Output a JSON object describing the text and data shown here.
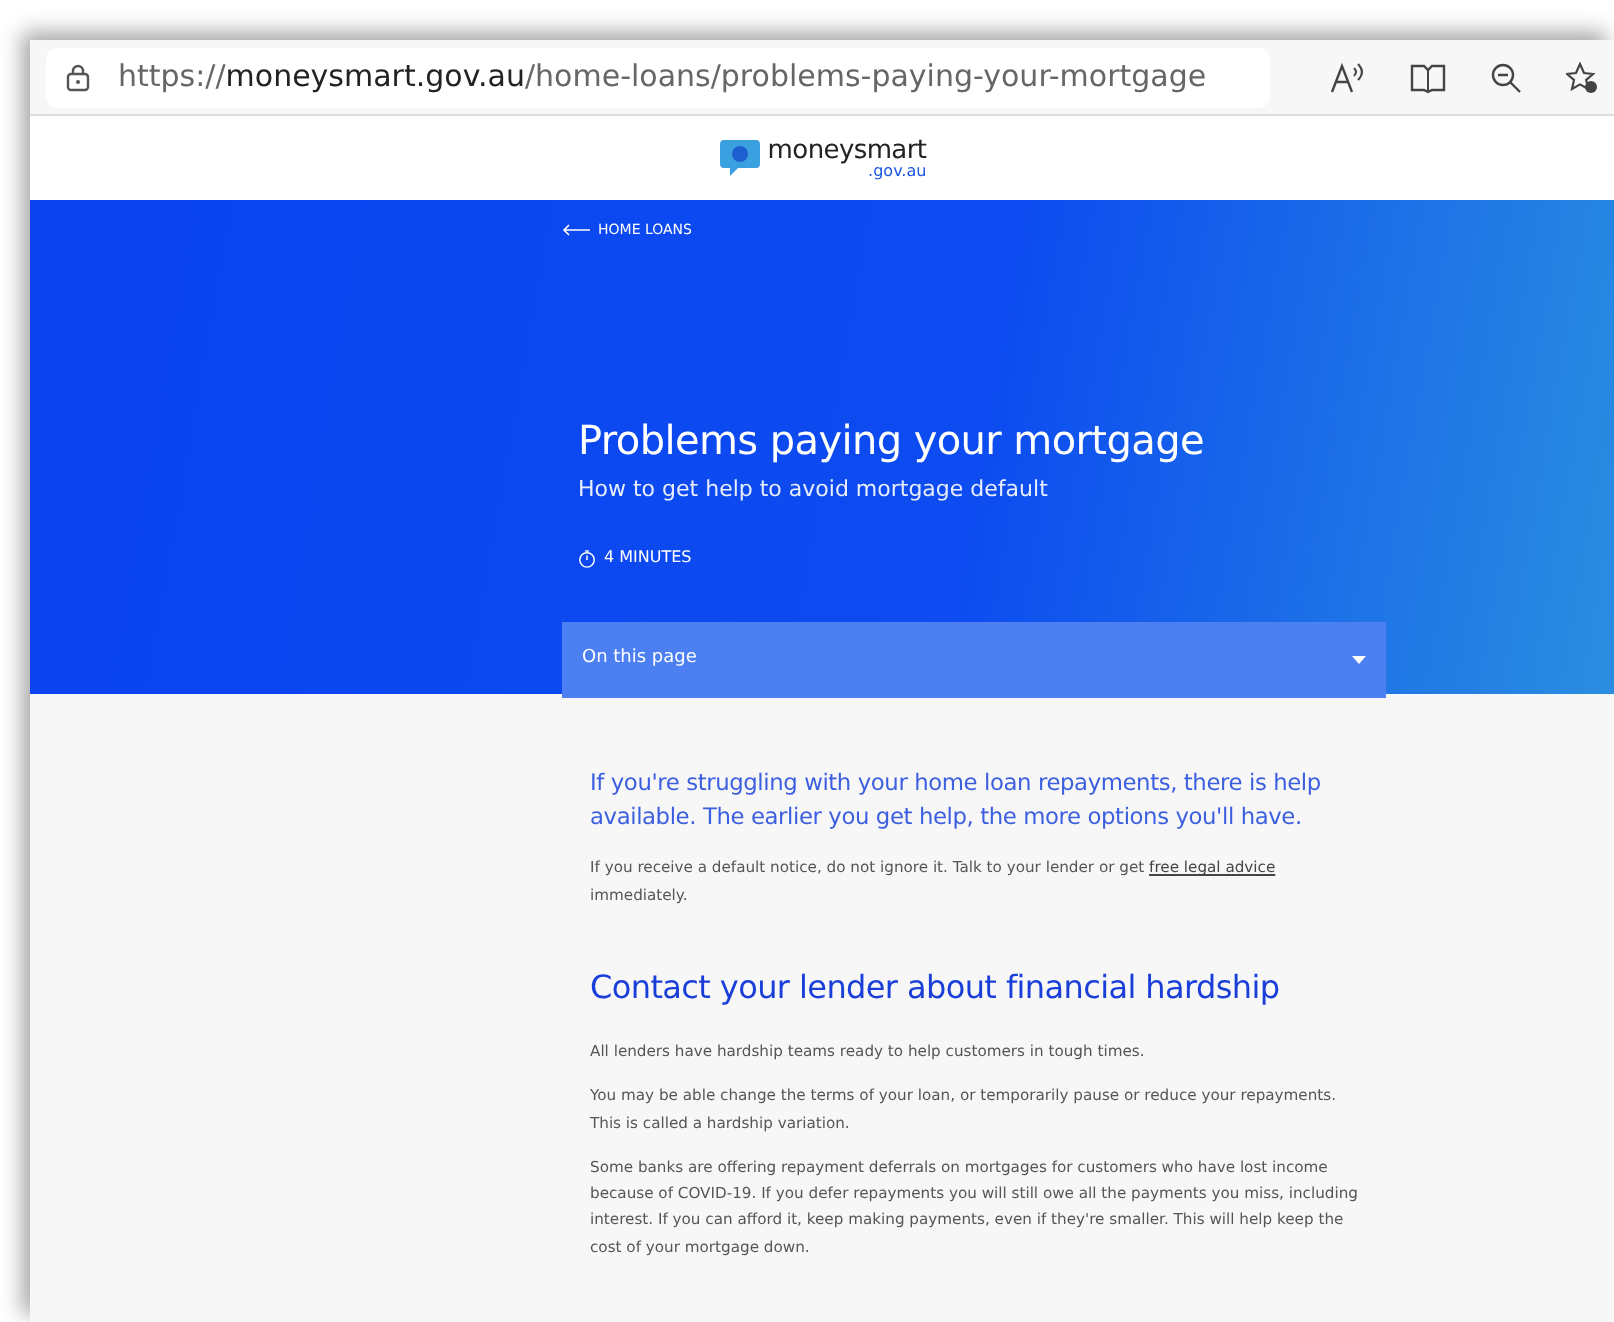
{
  "address_bar": {
    "scheme": "https://",
    "host": "moneysmart.gov.au",
    "path": "/home-loans/problems-paying-your-mortgage"
  },
  "logo": {
    "name": "moneysmart",
    "domain": ".gov.au"
  },
  "hero": {
    "back_link": "HOME LOANS",
    "title": "Problems paying your mortgage",
    "subtitle": "How to get help to avoid mortgage default",
    "read_time": "4 MINUTES",
    "toc": {
      "label": "On this page",
      "expanded": false
    }
  },
  "content": [
    {
      "kind": "lead",
      "text": "If you're struggling with your home loan repayments, there is help available. The earlier you get help, the more options you'll have."
    },
    {
      "kind": "para",
      "text": "If you receive a default notice, do not ignore it. Talk to your lender or get ",
      "link": "free legal advice",
      "after": " immediately."
    },
    {
      "kind": "heading",
      "text": "Contact your lender about financial hardship"
    },
    {
      "kind": "para",
      "text": "All lenders have hardship teams ready to help customers in tough times."
    },
    {
      "kind": "para",
      "text": "You may be able change the terms of your loan, or temporarily pause or reduce your repayments. This is called a hardship variation."
    },
    {
      "kind": "para",
      "text": "Some banks are offering repayment deferrals on mortgages for customers who have lost income because of COVID-19. If you defer repayments you will still owe all the payments you miss, including interest. If you can afford it, keep making payments, even if they're smaller. This will help keep the cost of your mortgage down."
    }
  ]
}
